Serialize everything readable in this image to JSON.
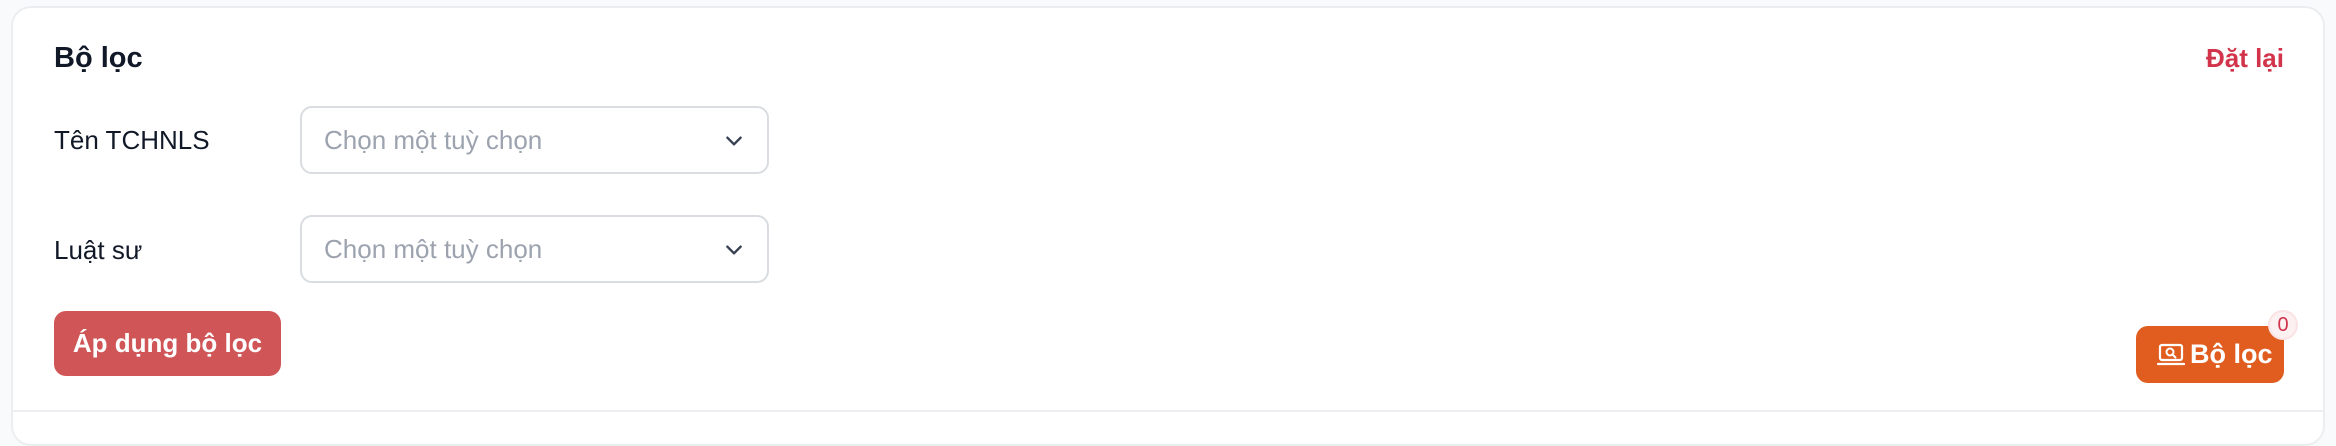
{
  "filter_panel": {
    "title": "Bộ lọc",
    "reset_label": "Đặt lại",
    "fields": [
      {
        "label": "Tên TCHNLS",
        "placeholder": "Chọn một tuỳ chọn"
      },
      {
        "label": "Luật sư",
        "placeholder": "Chọn một tuỳ chọn"
      }
    ],
    "apply_label": "Áp dụng bộ lọc"
  },
  "filter_toggle": {
    "label": "Bộ lọc",
    "icon": "filter-box-icon",
    "badge_count": "0"
  },
  "colors": {
    "reset_text": "#d1344b",
    "apply_button": "#cf5557",
    "filter_button": "#e05d1f"
  }
}
